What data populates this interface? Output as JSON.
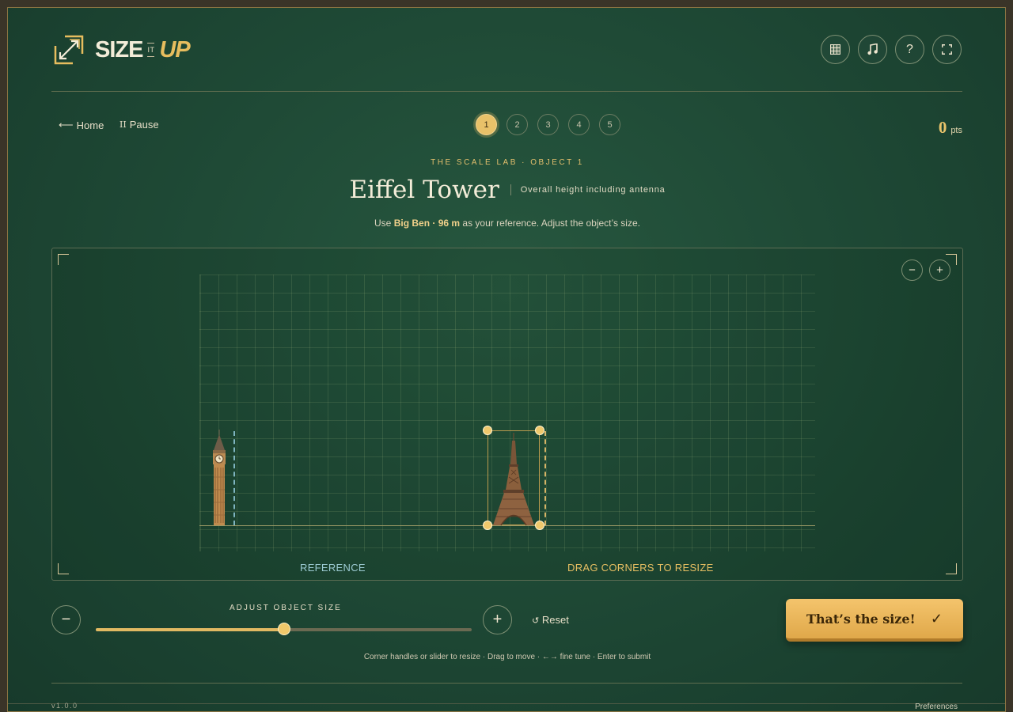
{
  "app": {
    "logo_size": "SIZE",
    "logo_it": "IT",
    "logo_up": "UP",
    "header_icons": [
      "grid-icon",
      "music-icon",
      "help-icon",
      "fullscreen-icon"
    ],
    "help_glyph": "?"
  },
  "nav": {
    "home_label": "Home",
    "pause_label": "Pause",
    "steps": [
      "1",
      "2",
      "3",
      "4",
      "5"
    ],
    "active_step": 1,
    "score_value": "0",
    "score_unit": "pts"
  },
  "challenge": {
    "kicker": "THE SCALE LAB · OBJECT 1",
    "title": "Eiffel Tower",
    "subtitle": "Overall height including antenna",
    "instr_prefix": "Use ",
    "reference_name": "Big Ben · 96 m",
    "instr_suffix": " as your reference. Adjust the object’s size."
  },
  "stage": {
    "zoom_out": "−",
    "zoom_in": "+",
    "reference_label": "REFERENCE",
    "object_label": "DRAG CORNERS TO RESIZE",
    "reference_object": "big-ben",
    "target_object": "eiffel-tower"
  },
  "controls": {
    "slider_label": "ADJUST OBJECT SIZE",
    "slider_value": 0.5,
    "minus": "−",
    "plus": "+",
    "reset_label": "Reset",
    "submit_label": "That’s the size!",
    "submit_check": "✓",
    "hint": "Corner handles or slider to resize · Drag to move · ←→ fine tune · Enter to submit"
  },
  "footer": {
    "version": "v1.0.0",
    "preferences": "Preferences"
  },
  "colors": {
    "accent": "#e8c169",
    "background": "#1f4a36",
    "reference_line": "#7fb5c0"
  }
}
